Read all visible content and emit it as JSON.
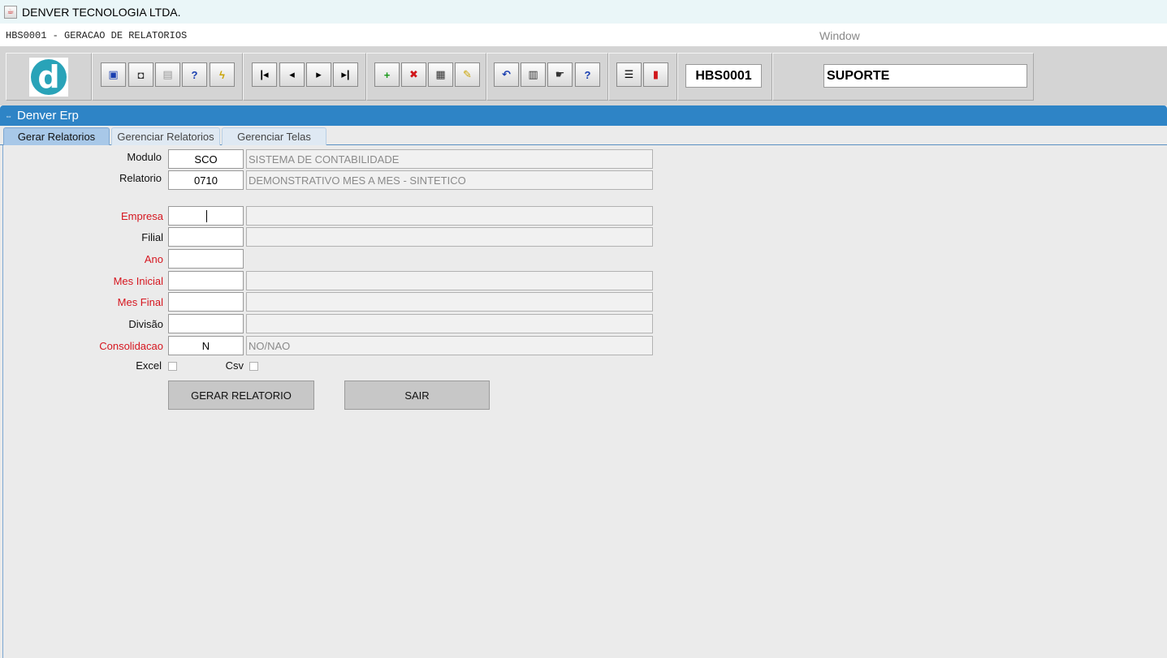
{
  "window": {
    "title": "DENVER TECNOLOGIA LTDA."
  },
  "menubar": {
    "form_name": "HBS0001 - GERACAO DE RELATORIOS",
    "window_menu": "Window"
  },
  "toolbar": {
    "form_code": "HBS0001",
    "user": "SUPORTE",
    "buttons": [
      {
        "name": "save-button",
        "icon": "floppy-icon",
        "glyph": "▣",
        "color": "#1a3fb0"
      },
      {
        "name": "enter-query-button",
        "icon": "window-icon",
        "glyph": "◘",
        "color": "#333"
      },
      {
        "name": "print-button",
        "icon": "printer-icon",
        "glyph": "▤",
        "color": "#999"
      },
      {
        "name": "query-help-button",
        "icon": "query-question-icon",
        "glyph": "?",
        "color": "#1a3fb0"
      },
      {
        "name": "execute-query-button",
        "icon": "lightning-icon",
        "glyph": "ϟ",
        "color": "#c9a300"
      },
      {
        "name": "first-record-button",
        "icon": "first-icon",
        "glyph": "|◂",
        "color": "#000"
      },
      {
        "name": "previous-record-button",
        "icon": "previous-icon",
        "glyph": "◂",
        "color": "#000"
      },
      {
        "name": "next-record-button",
        "icon": "next-icon",
        "glyph": "▸",
        "color": "#000"
      },
      {
        "name": "last-record-button",
        "icon": "last-icon",
        "glyph": "▸|",
        "color": "#000"
      },
      {
        "name": "insert-record-button",
        "icon": "plus-icon",
        "glyph": "+",
        "color": "#1a9a1a"
      },
      {
        "name": "delete-record-button",
        "icon": "x-icon",
        "glyph": "✖",
        "color": "#d0161a"
      },
      {
        "name": "list-values-button",
        "icon": "list-icon",
        "glyph": "▦",
        "color": "#333"
      },
      {
        "name": "edit-button",
        "icon": "pencil-icon",
        "glyph": "✎",
        "color": "#c9a300"
      },
      {
        "name": "undo-button",
        "icon": "undo-icon",
        "glyph": "↶",
        "color": "#1a3fb0"
      },
      {
        "name": "clipboard-button",
        "icon": "clipboard-icon",
        "glyph": "▥",
        "color": "#333"
      },
      {
        "name": "help-hand-button",
        "icon": "hand-icon",
        "glyph": "☛",
        "color": "#333"
      },
      {
        "name": "help-button",
        "icon": "question-icon",
        "glyph": "?",
        "color": "#1a3fb0"
      },
      {
        "name": "menu-button",
        "icon": "menu-icon",
        "glyph": "☰",
        "color": "#000"
      },
      {
        "name": "exit-button",
        "icon": "door-exit-icon",
        "glyph": "▮",
        "color": "#d0161a"
      }
    ]
  },
  "header": {
    "label": "Denver Erp"
  },
  "tabs": [
    {
      "label": "Gerar Relatorios",
      "active": true
    },
    {
      "label": "Gerenciar Relatorios",
      "active": false
    },
    {
      "label": "Gerenciar Telas",
      "active": false
    }
  ],
  "form": {
    "modulo": {
      "label": "Modulo",
      "code": "SCO",
      "desc": "SISTEMA DE CONTABILIDADE"
    },
    "relatorio": {
      "label": "Relatorio",
      "code": "0710",
      "desc": "DEMONSTRATIVO MES A MES - SINTETICO"
    },
    "empresa": {
      "label": "Empresa",
      "code": "",
      "desc": ""
    },
    "filial": {
      "label": "Filial",
      "code": "",
      "desc": ""
    },
    "ano": {
      "label": "Ano",
      "code": ""
    },
    "mes_inicial": {
      "label": "Mes Inicial",
      "code": "",
      "desc": ""
    },
    "mes_final": {
      "label": "Mes Final",
      "code": "",
      "desc": ""
    },
    "divisao": {
      "label": "Divisão",
      "code": "",
      "desc": ""
    },
    "consolidacao": {
      "label": "Consolidacao",
      "code": "N",
      "desc": "NO/NAO"
    },
    "excel_label": "Excel",
    "csv_label": "Csv",
    "gerar_label": "GERAR RELATORIO",
    "sair_label": "SAIR"
  }
}
